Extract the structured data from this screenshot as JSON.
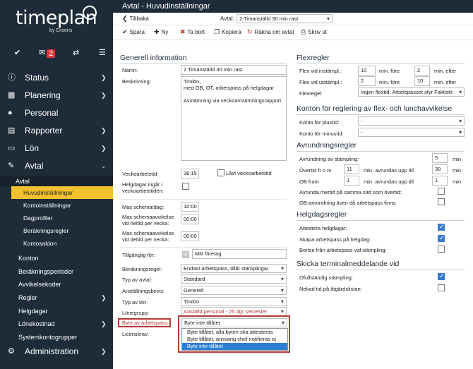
{
  "brand": {
    "logo": "timeplan",
    "byline": "by Exsens"
  },
  "iconbar": {
    "badge": "2"
  },
  "nav": [
    {
      "label": "Status",
      "icon": "info-icon"
    },
    {
      "label": "Planering",
      "icon": "calendar-icon"
    },
    {
      "label": "Personal",
      "icon": "person-icon"
    },
    {
      "label": "Rapporter",
      "icon": "report-icon"
    },
    {
      "label": "Lön",
      "icon": "wallet-icon"
    },
    {
      "label": "Avtal",
      "icon": "wrench-icon"
    }
  ],
  "avtal_sub": {
    "header": "Avtal",
    "items": [
      "Huvudinställningar",
      "Kontoinställningar",
      "Dagprofiler",
      "Beräkningsregler",
      "Kontosaldon"
    ]
  },
  "other_nav": [
    "Konton",
    "Beräkningsperioder",
    "Avvikelsekoder",
    "Regler",
    "Helgdagar",
    "Lönekostnad",
    "Systemkontogrupper"
  ],
  "admin": {
    "label": "Administration"
  },
  "topbar": {
    "title": "Avtal - Huvudinställningar"
  },
  "backrow": {
    "back_label": "Tillbaka",
    "avtal_label": "Avtal:",
    "avtal_value": "2 Timanställd 30 min rast"
  },
  "toolbar": {
    "save": "Spara",
    "new": "Ny",
    "delete": "Ta bort",
    "copy": "Kopiera",
    "recalc": "Räkna om avtal",
    "print": "Skriv ut"
  },
  "general": {
    "title": "Generell information",
    "name_label": "Namn:",
    "name_value": "2 Timanställd 30 min rast",
    "desc_label": "Beskrivning:",
    "desc_value": "Timlön,\nmed OB, ÖT, arbetspass på helgdagar\n\nAvstämning via veckoavstämningsrapport",
    "weekly_label": "Veckoarbetstid:",
    "weekly_value": "38:15",
    "locked_label": "Låst veckoarbetstid",
    "holiday_label": "Helgdagar ingår i veckoarbetstiden:",
    "maxday_label": "Max schema/dag:",
    "maxday_value": "10:00",
    "maxdev_full_label": "Max schemaavvikelse vid heltid per vecka:",
    "maxdev_full_value": "00:00",
    "maxdev_part_label": "Max schemaavvikelse vid deltid per vecka:",
    "maxdev_part_value": "00:00",
    "available_label": "Tillgänglig för:",
    "available_value": "Mitt företag",
    "calc_label": "Beräkningsregel:",
    "calc_value": "Endast arbetspass, tillåt stämplingar",
    "type_label": "Typ av avtal:",
    "type_value": "Standard",
    "cert_label": "Anställningsbevis:",
    "cert_value": "Generell",
    "salarytype_label": "Typ av lön:",
    "salarytype_value": "Timlön",
    "salarygroup_label": "Lönegrupp:",
    "salarygroup_value": "Anställd personal - 25 dgr semester",
    "swap_label": "Byte av arbetspass:",
    "swap_value": "Byte inte tillåtet",
    "license_label": "Licenskrav:",
    "swap_options": [
      "Byte tillåtet, alla byten ska attesteras",
      "Byte tillåtet, ansvarig chef notifieras ej",
      "Byte inte tillåtet"
    ]
  },
  "flex": {
    "title": "Flexregler",
    "in_label": "Flex vid instämpl.:",
    "in_v1": "10",
    "in_mid": "min. före",
    "in_v2": "2",
    "in_end": "min. efter",
    "out_label": "Flex vid utstämpl.:",
    "out_v1": "2",
    "out_mid": "min. före",
    "out_v2": "10",
    "out_end": "min. efter",
    "rule_label": "Flexregel:",
    "rule_value": "Ingen flextid, Arbetspasset styr Faktiskt"
  },
  "accounts": {
    "title": "Konton för reglering av flex- och lunchavvikelse",
    "plus_label": "Konto för plustid:",
    "plus_value": "-",
    "minus_label": "Konto för minustid:",
    "minus_value": "-"
  },
  "rounding": {
    "title": "Avrundningsregler",
    "stamp_label": "Avrundning av stämpling:",
    "stamp_value": "5",
    "stamp_unit": "min",
    "ot_label": "Övertid fr o m",
    "ot_v1": "11",
    "ot_mid": "min. avrundas upp till",
    "ot_v2": "30",
    "ot_unit": "min",
    "ob_label": "OB from",
    "ob_v1": "1",
    "ob_mid": "min. avrundas upp till",
    "ob_v2": "1",
    "ob_unit": "min",
    "meal_label": "Avrunda mertid på samma sätt som övertid:",
    "obround_label": "OB-avrundning även då arbetspass finns:"
  },
  "holidays": {
    "title": "Helgdagsregler",
    "attest_label": "Attestera helgdagar:",
    "create_label": "Skapa arbetspass på helgdag:",
    "skip_label": "Bortse från arbetspass vid stämpling:"
  },
  "terminal": {
    "title": "Skicka terminalmeddelande vid",
    "incomplete_label": "Ofullständig stämpling:",
    "denied_label": "Nekad tid på åtgärdslistan:"
  }
}
